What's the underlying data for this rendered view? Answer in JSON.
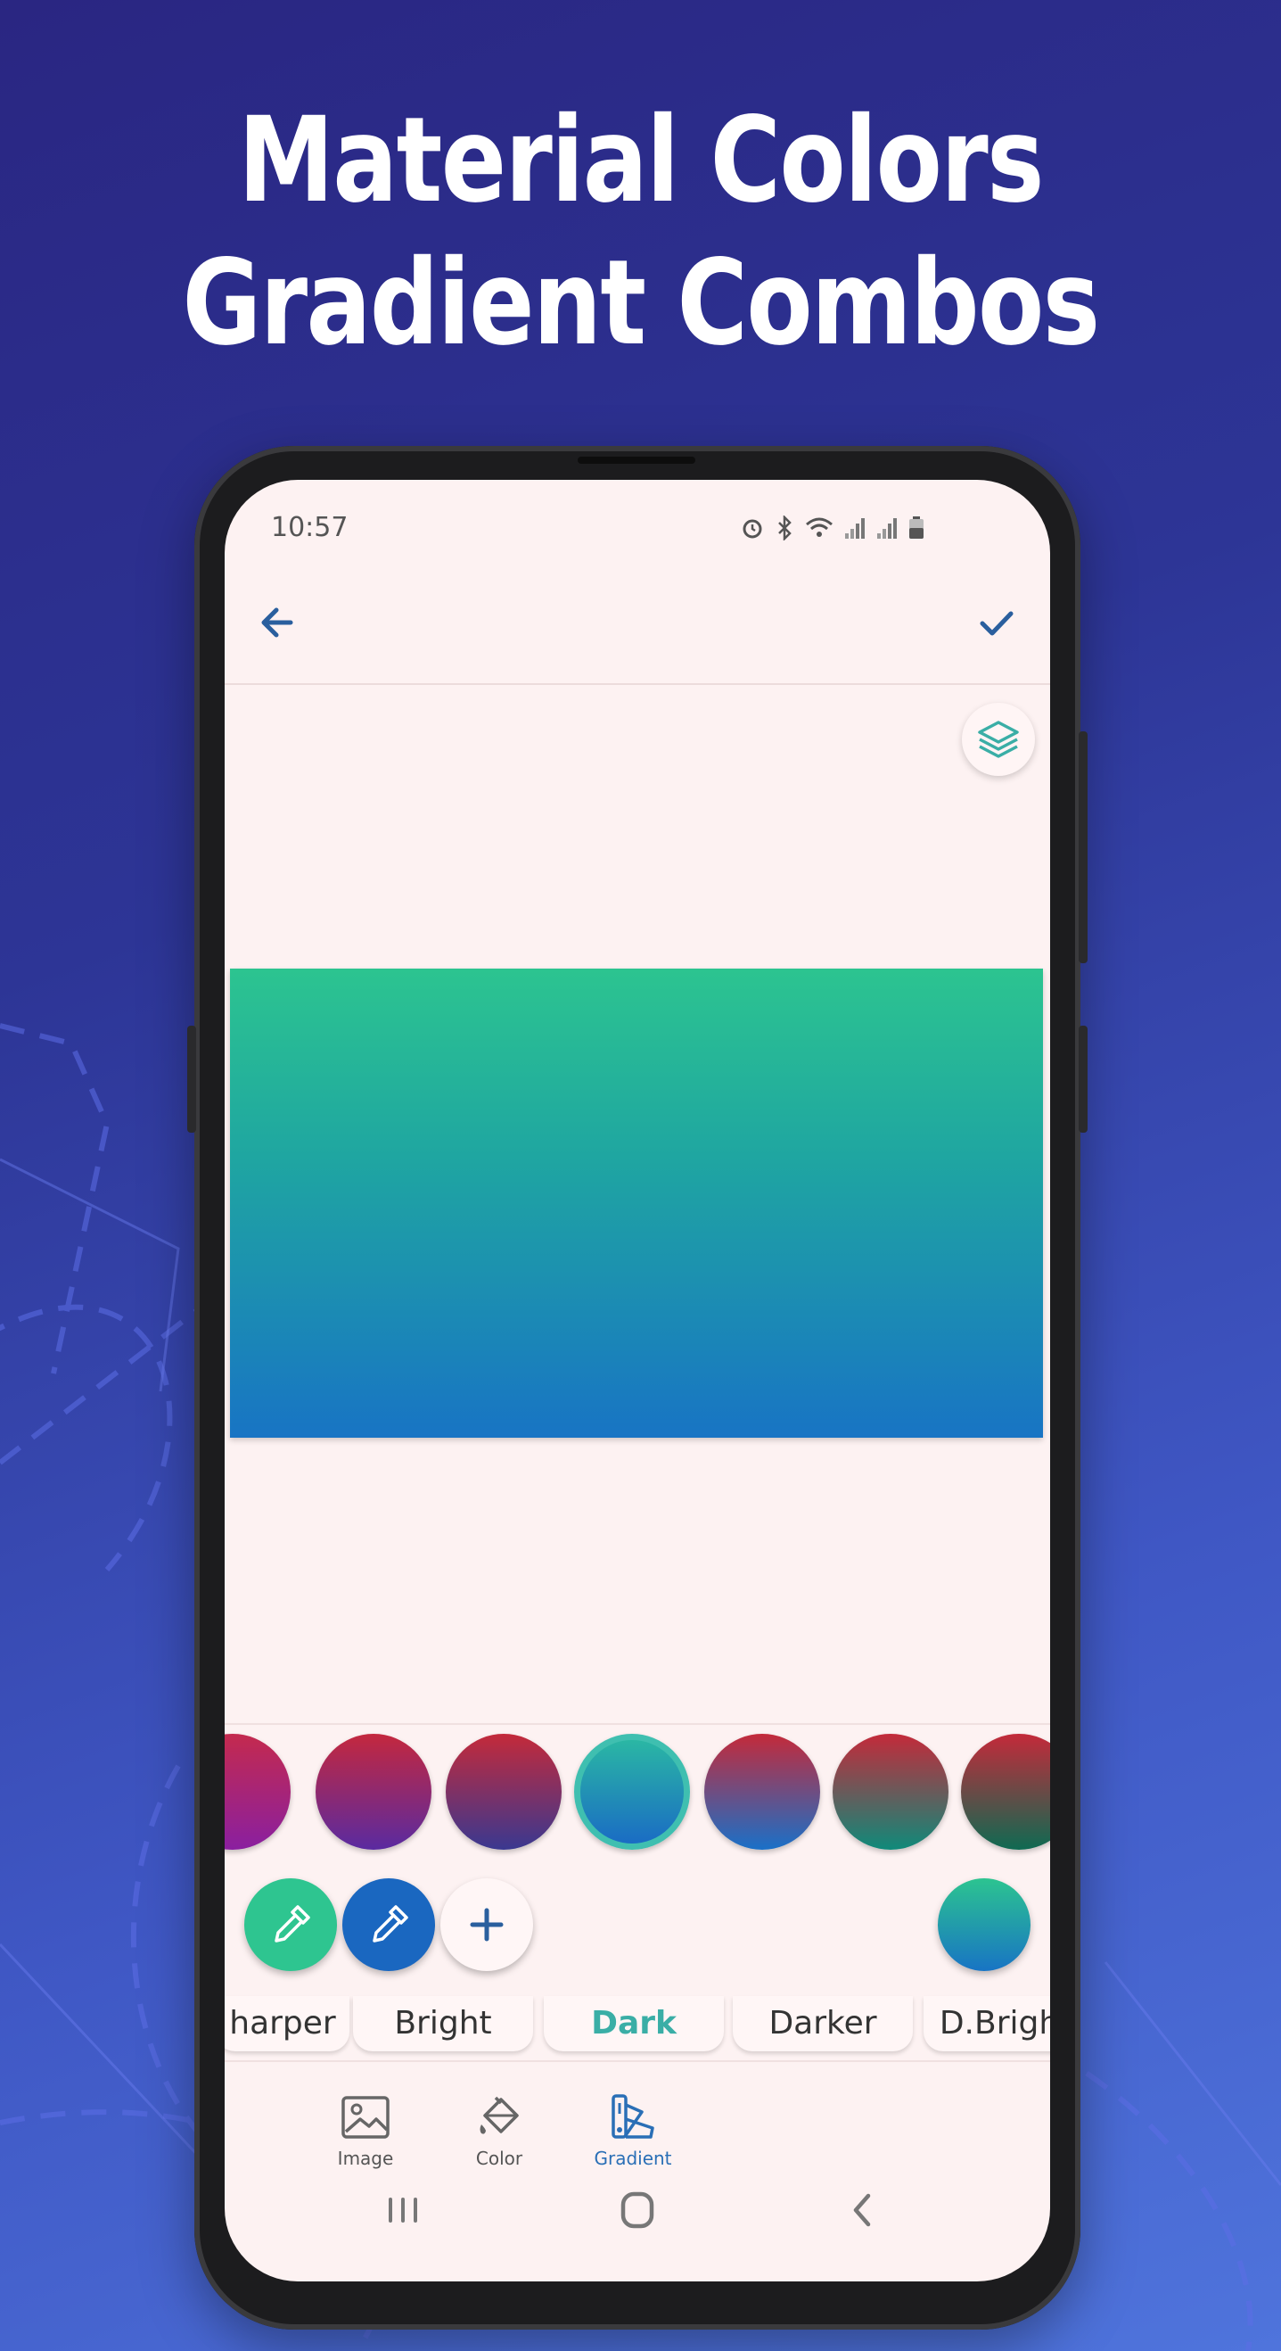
{
  "promo": {
    "headline_line1": "Material Colors",
    "headline_line2": "Gradient Combos"
  },
  "status_bar": {
    "time": "10:57",
    "icons": [
      "alarm-icon",
      "bluetooth-icon",
      "wifi-icon",
      "signal-icon",
      "signal-icon",
      "battery-icon"
    ]
  },
  "toolbar": {
    "back_icon": "back-arrow-icon",
    "confirm_icon": "check-icon",
    "layers_icon": "layers-icon"
  },
  "preview": {
    "gradient": [
      "#2cc490",
      "#1874c4"
    ]
  },
  "swatches": [
    {
      "from": "#c42a4e",
      "to": "#8a1fa0"
    },
    {
      "from": "#c4283e",
      "to": "#5a2aa0"
    },
    {
      "from": "#c42a3a",
      "to": "#3a3890"
    },
    {
      "from": "#2ab7a4",
      "to": "#1a6cc4",
      "selected": true
    },
    {
      "from": "#c42a3a",
      "to": "#1a70c8"
    },
    {
      "from": "#c42a3a",
      "to": "#0f8a7a"
    },
    {
      "from": "#c42a3a",
      "to": "#0f6a52"
    }
  ],
  "actions": {
    "start_color_picker": {
      "icon": "eyedropper-icon",
      "color": "#2ec590"
    },
    "end_color_picker": {
      "icon": "eyedropper-icon",
      "color": "#1a67c0"
    },
    "add_button": {
      "icon": "plus-icon"
    },
    "current_gradient": {
      "from": "#2cc490",
      "to": "#1874c4"
    }
  },
  "filter_tabs": [
    {
      "label": "harper"
    },
    {
      "label": "Bright"
    },
    {
      "label": "Dark",
      "active": true
    },
    {
      "label": "Darker"
    },
    {
      "label": "D.Brigh"
    }
  ],
  "bottom_nav": [
    {
      "label": "Image",
      "icon": "image-icon"
    },
    {
      "label": "Color",
      "icon": "paint-bucket-icon"
    },
    {
      "label": "Gradient",
      "icon": "gradient-palette-icon",
      "active": true
    }
  ],
  "system_nav": [
    "recents-icon",
    "home-icon",
    "back-icon"
  ],
  "colors": {
    "accent": "#3aaea6",
    "nav_active": "#2a6fb6",
    "screen_bg": "#fdf2f2"
  }
}
